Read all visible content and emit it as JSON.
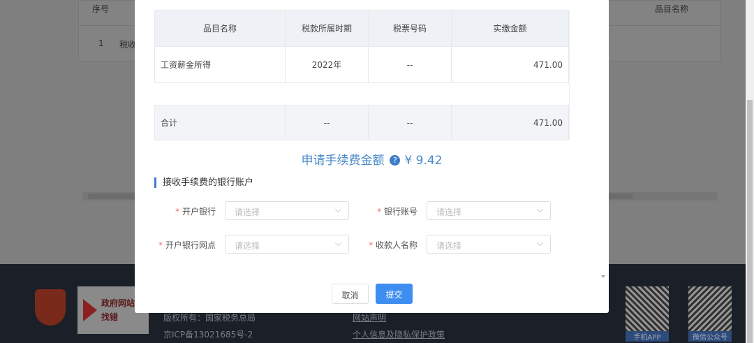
{
  "background": {
    "table_headers": [
      "序号",
      "品目名称"
    ],
    "row": [
      "1",
      "税收"
    ]
  },
  "modal": {
    "table": {
      "headers": [
        "品目名称",
        "税款所属时期",
        "税票号码",
        "实缴金额"
      ],
      "rows": [
        [
          "工资薪金所得",
          "2022年",
          "--",
          "471.00"
        ]
      ],
      "total": [
        "合计",
        "--",
        "--",
        "471.00"
      ]
    },
    "fee_label": "申请手续费金额",
    "fee_help": "?",
    "fee_amount": "¥ 9.42",
    "section_title": "接收手续费的银行账户",
    "fields": [
      {
        "label": "开户银行",
        "placeholder": "请选择"
      },
      {
        "label": "银行账号",
        "placeholder": "请选择"
      },
      {
        "label": "开户银行网点",
        "placeholder": "请选择"
      },
      {
        "label": "收款人名称",
        "placeholder": "请选择"
      }
    ],
    "required_mark": "*",
    "cancel": "取消",
    "submit": "提交"
  },
  "footer": {
    "copyright": "版权所有：国家税务总局",
    "icp": "京ICP备13021685号-2",
    "links": [
      "网站声明",
      "个人信息及隐私保护政策"
    ],
    "qr_labels": [
      "手机APP",
      "微信公众号"
    ],
    "gov_badge": "政府网站 找错"
  }
}
